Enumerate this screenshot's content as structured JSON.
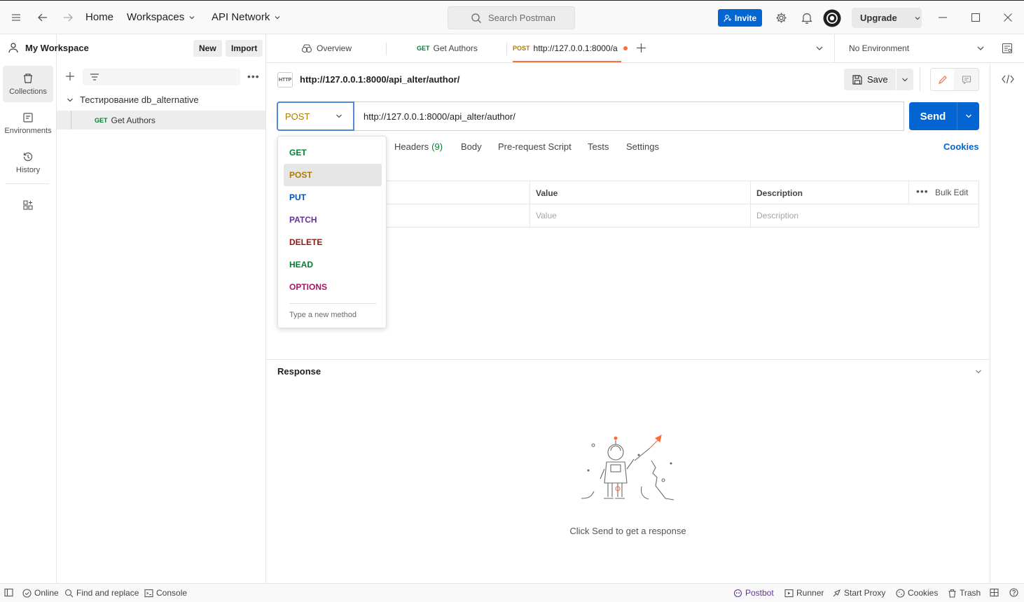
{
  "topbar": {
    "home": "Home",
    "workspaces": "Workspaces",
    "api_network": "API Network",
    "search_placeholder": "Search Postman",
    "invite": "Invite",
    "upgrade": "Upgrade"
  },
  "rail": {
    "collections": "Collections",
    "environments": "Environments",
    "history": "History"
  },
  "sidebar": {
    "workspace_name": "My Workspace",
    "new_label": "New",
    "import_label": "Import",
    "collection_name": "Тестирование db_alternative",
    "request_method": "GET",
    "request_name": "Get Authors"
  },
  "tabs": {
    "overview": "Overview",
    "tab2_method": "GET",
    "tab2_name": "Get Authors",
    "tab3_method": "POST",
    "tab3_name": "http://127.0.0.1:8000/a",
    "environment": "No Environment"
  },
  "request": {
    "http_badge": "HTTP",
    "title": "http://127.0.0.1:8000/api_alter/author/",
    "save": "Save",
    "method": "POST",
    "url": "http://127.0.0.1:8000/api_alter/author/",
    "send": "Send",
    "tabs": {
      "headers": "Headers",
      "headers_count": "(9)",
      "body": "Body",
      "prerequest": "Pre-request Script",
      "tests": "Tests",
      "settings": "Settings",
      "cookies": "Cookies"
    },
    "table": {
      "value_header": "Value",
      "description_header": "Description",
      "bulk_edit": "Bulk Edit",
      "value_placeholder": "Value",
      "description_placeholder": "Description"
    }
  },
  "method_dropdown": {
    "items": [
      "GET",
      "POST",
      "PUT",
      "PATCH",
      "DELETE",
      "HEAD",
      "OPTIONS"
    ],
    "selected": "POST",
    "new_method_placeholder": "Type a new method"
  },
  "response": {
    "title": "Response",
    "empty_message": "Click Send to get a response"
  },
  "statusbar": {
    "online": "Online",
    "find_replace": "Find and replace",
    "console": "Console",
    "postbot": "Postbot",
    "runner": "Runner",
    "start_proxy": "Start Proxy",
    "cookies": "Cookies",
    "trash": "Trash"
  },
  "colors": {
    "accent": "#0265d2",
    "get": "#007f31",
    "post": "#ad7a03",
    "put": "#0053b8",
    "patch": "#623497",
    "delete": "#8e1a10",
    "options": "#a61468",
    "unsaved_dot": "#ff6c37"
  }
}
